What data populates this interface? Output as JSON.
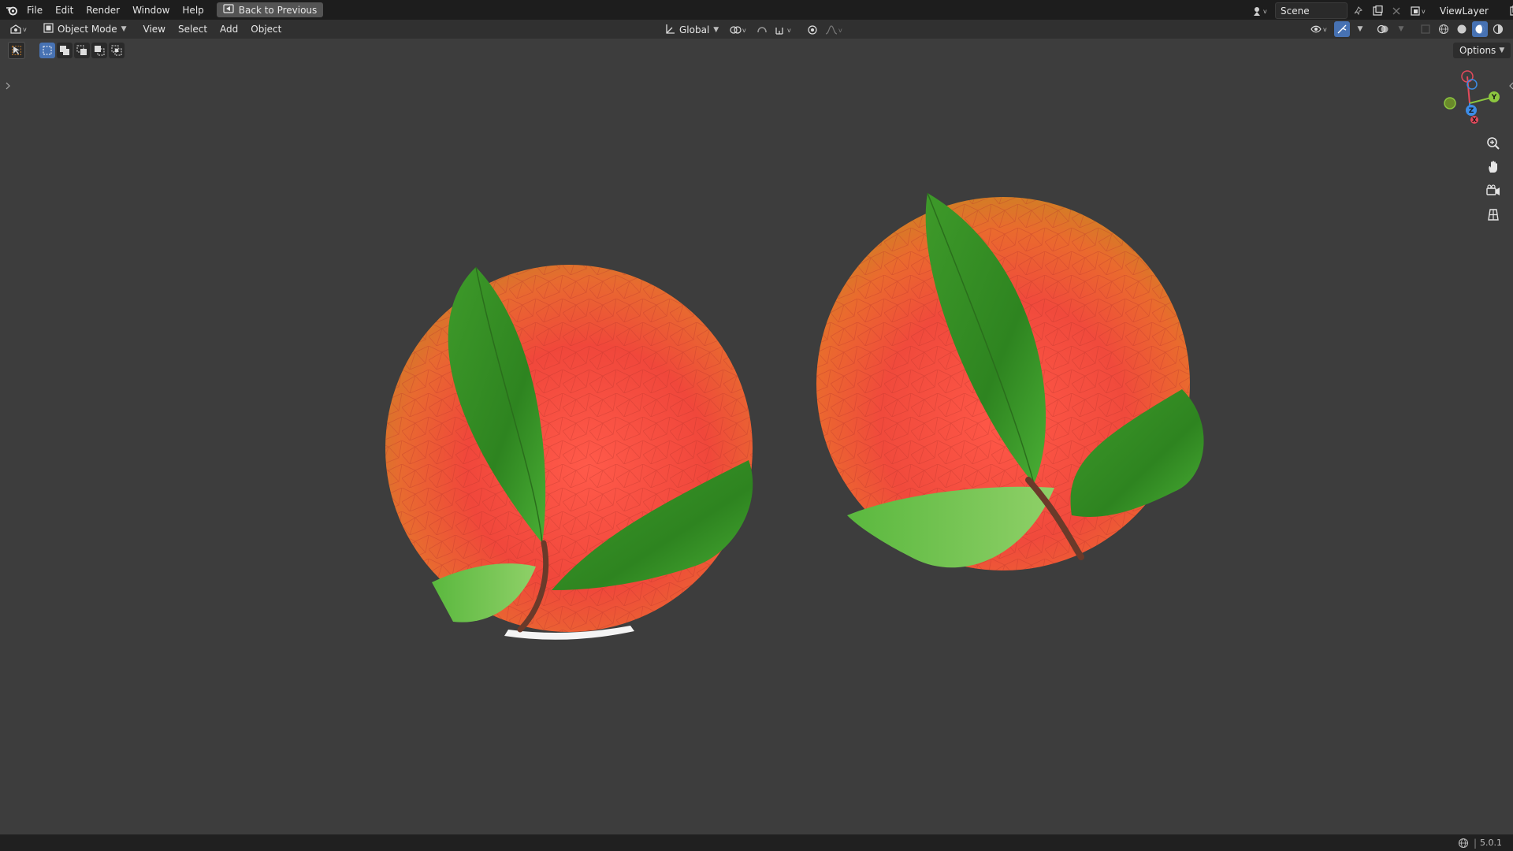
{
  "topbar": {
    "menus": [
      "File",
      "Edit",
      "Render",
      "Window",
      "Help"
    ],
    "back_label": "Back to Previous",
    "scene_name": "Scene",
    "viewlayer_name": "ViewLayer"
  },
  "header": {
    "mode_label": "Object Mode",
    "menus": [
      "View",
      "Select",
      "Add",
      "Object"
    ],
    "orientation_label": "Global"
  },
  "viewport": {
    "options_label": "Options",
    "gizmo_labels": {
      "x": "X",
      "y": "Y",
      "z": "Z"
    }
  },
  "statusbar": {
    "version": "5.0.1"
  },
  "colors": {
    "axis_x": "#e44a5c",
    "axis_y": "#8cc63f",
    "axis_z": "#3c8ce6",
    "accent": "#4772b3"
  },
  "icons": [
    "blender-logo-icon",
    "back-icon",
    "scene-icon",
    "pin-icon",
    "new-scene-icon",
    "close-icon",
    "viewlayer-icon",
    "editor-type-icon",
    "object-mode-icon",
    "orientation-icon",
    "pivot-icon",
    "snap-icon",
    "proportional-icon",
    "visibility-icon",
    "gizmo-icon",
    "overlay-icon",
    "xray-icon",
    "wireframe-shading-icon",
    "solid-shading-icon",
    "material-shading-icon",
    "rendered-shading-icon",
    "zoom-icon",
    "pan-icon",
    "camera-icon",
    "grid-icon",
    "network-icon"
  ]
}
